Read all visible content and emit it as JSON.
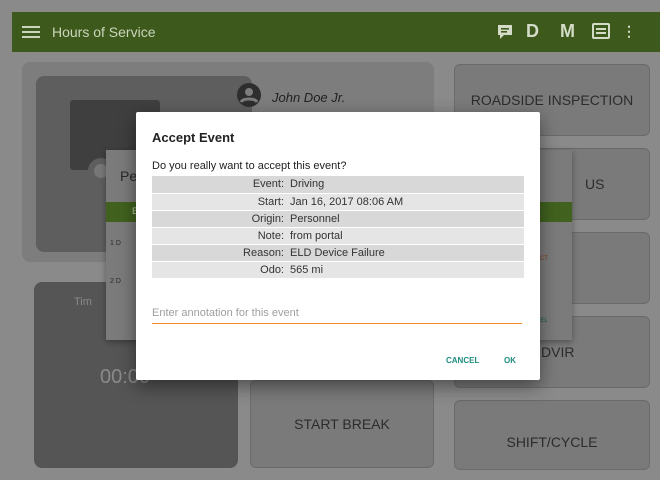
{
  "appbar": {
    "title": "Hours of Service",
    "actions": {
      "d_label": "D",
      "m_label": "M"
    },
    "icons": [
      "menu-icon",
      "message-icon",
      "device-icon",
      "overflow-menu-icon"
    ],
    "color": "#3d591c"
  },
  "background": {
    "driver_name": "John Doe Jr.",
    "timer_label": "Tim",
    "timer_value": "00:00",
    "buttons": {
      "roadside": "ROADSIDE INSPECTION",
      "status": "US",
      "dvir": "DVIR",
      "start_break": "START BREAK",
      "shift_cycle": "SHIFT/CYCLE"
    },
    "mid_dialog": {
      "title": "Pe",
      "header_fragment": "E",
      "rows": [
        "1  D",
        "2  D"
      ],
      "side_fragments": [
        "ECT",
        "CEL"
      ]
    }
  },
  "dialog": {
    "title": "Accept Event",
    "question": "Do you really want to accept this event?",
    "fields": [
      {
        "key": "Event:",
        "value": "Driving"
      },
      {
        "key": "Start:",
        "value": "Jan 16, 2017  08:06 AM"
      },
      {
        "key": "Origin:",
        "value": "Personnel"
      },
      {
        "key": "Note:",
        "value": "from portal"
      },
      {
        "key": "Reason:",
        "value": "ELD Device Failure"
      },
      {
        "key": "Odo:",
        "value": "565 mi"
      }
    ],
    "annotation_placeholder": "Enter annotation for this event",
    "annotation_value": "",
    "cancel_label": "CANCEL",
    "ok_label": "OK",
    "accent_color": "#f28a25",
    "button_color": "#1e8c7c"
  }
}
